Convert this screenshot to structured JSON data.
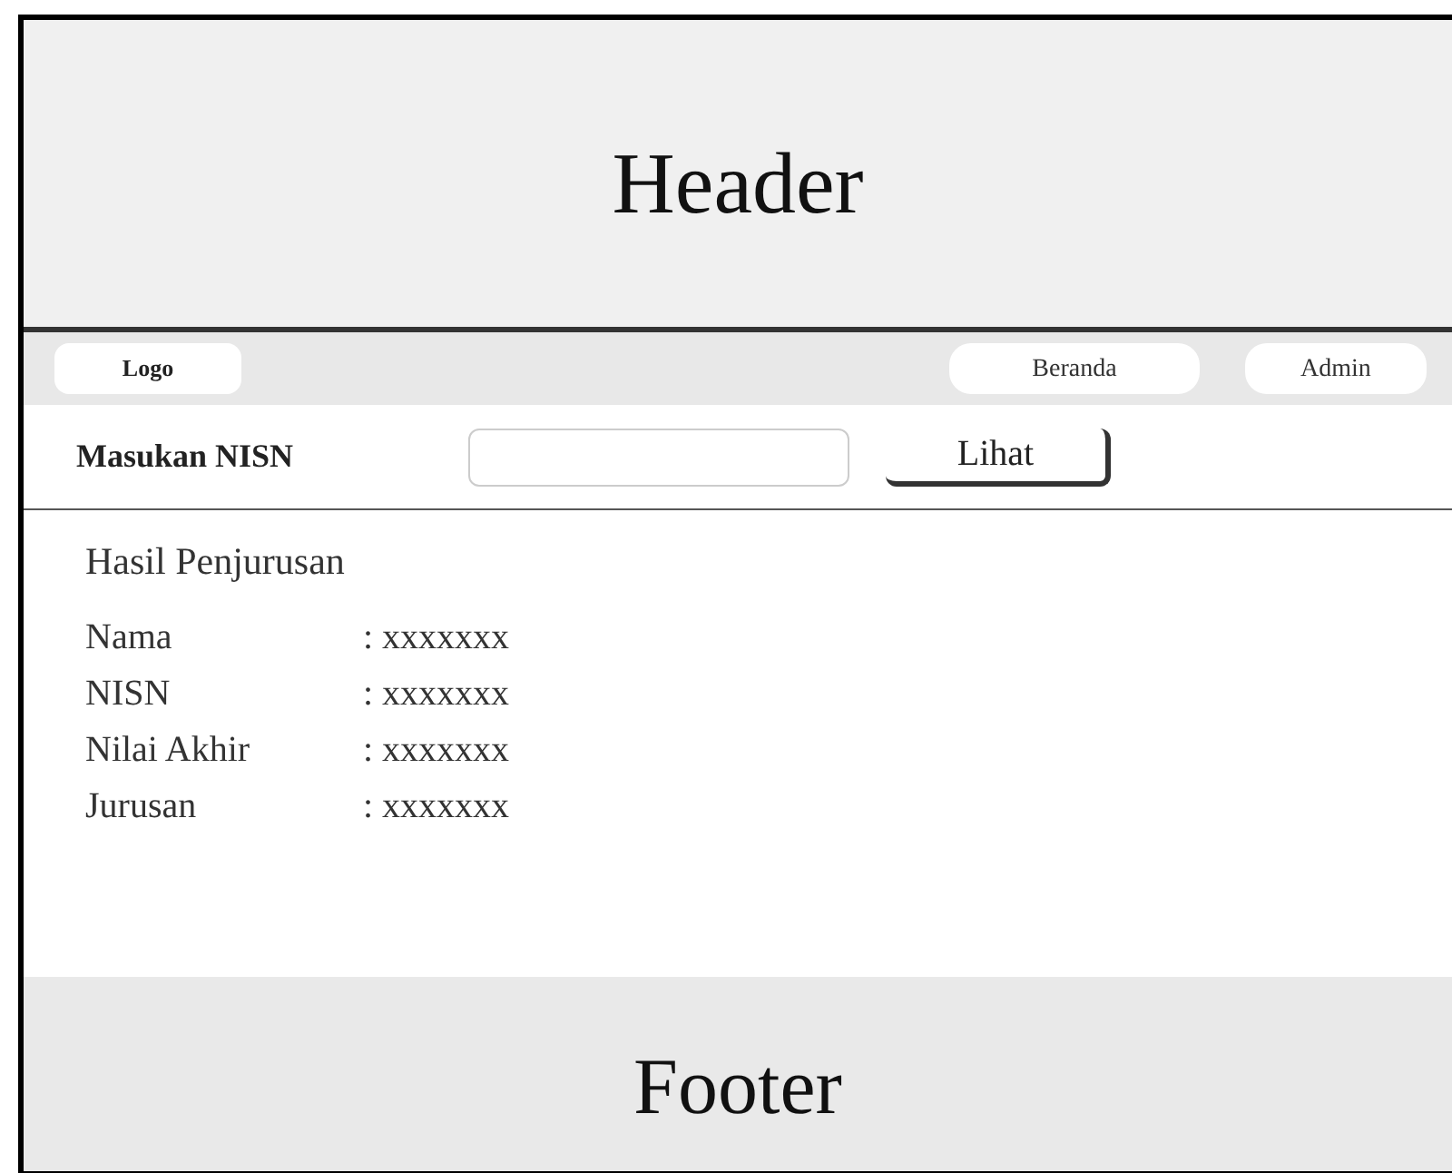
{
  "header": {
    "title": "Header"
  },
  "nav": {
    "logo": "Logo",
    "links": [
      {
        "label": "Beranda"
      },
      {
        "label": "Admin"
      }
    ]
  },
  "search": {
    "label": "Masukan NISN",
    "button": "Lihat"
  },
  "result": {
    "title": "Hasil Penjurusan",
    "rows": [
      {
        "label": "Nama",
        "value": ": xxxxxxx"
      },
      {
        "label": "NISN",
        "value": ": xxxxxxx"
      },
      {
        "label": "Nilai Akhir",
        "value": ": xxxxxxx"
      },
      {
        "label": "Jurusan",
        "value": ": xxxxxxx"
      }
    ]
  },
  "footer": {
    "title": "Footer"
  }
}
